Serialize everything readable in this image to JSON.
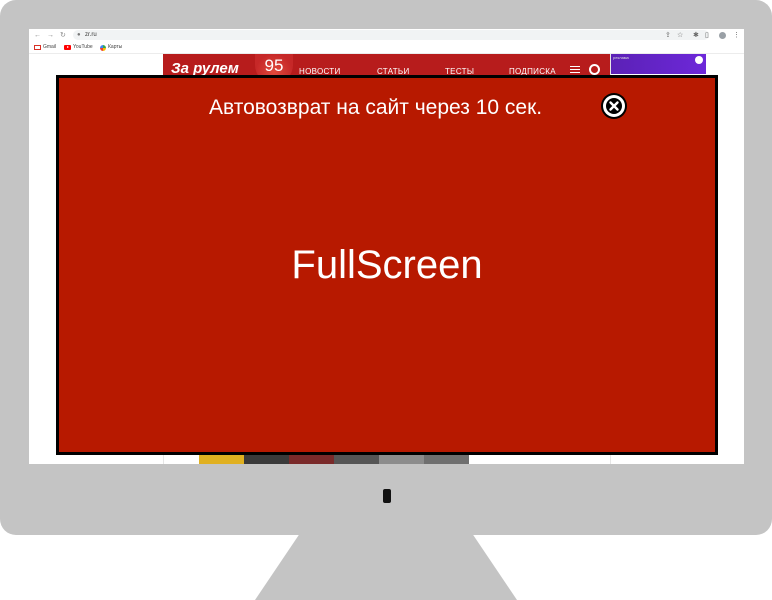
{
  "browser": {
    "url": "zr.ru",
    "bookmarks": [
      {
        "label": "Gmail",
        "icon": "gmail-icon"
      },
      {
        "label": "YouTube",
        "icon": "youtube-icon"
      },
      {
        "label": "Карты",
        "icon": "maps-icon"
      }
    ]
  },
  "site": {
    "logo": "За рулем",
    "anniversary": "95",
    "nav": [
      "НОВОСТИ",
      "СТАТЬИ",
      "ТЕСТЫ",
      "ПОДПИСКА"
    ],
    "ad_tag": "реклама"
  },
  "overlay": {
    "autoreturn_text": "Автовозврат на сайт через 10 сек.",
    "label": "FullScreen"
  },
  "colors": {
    "overlay_bg": "#b71900",
    "site_header": "#b71c1c",
    "monitor": "#c4c4c4"
  }
}
